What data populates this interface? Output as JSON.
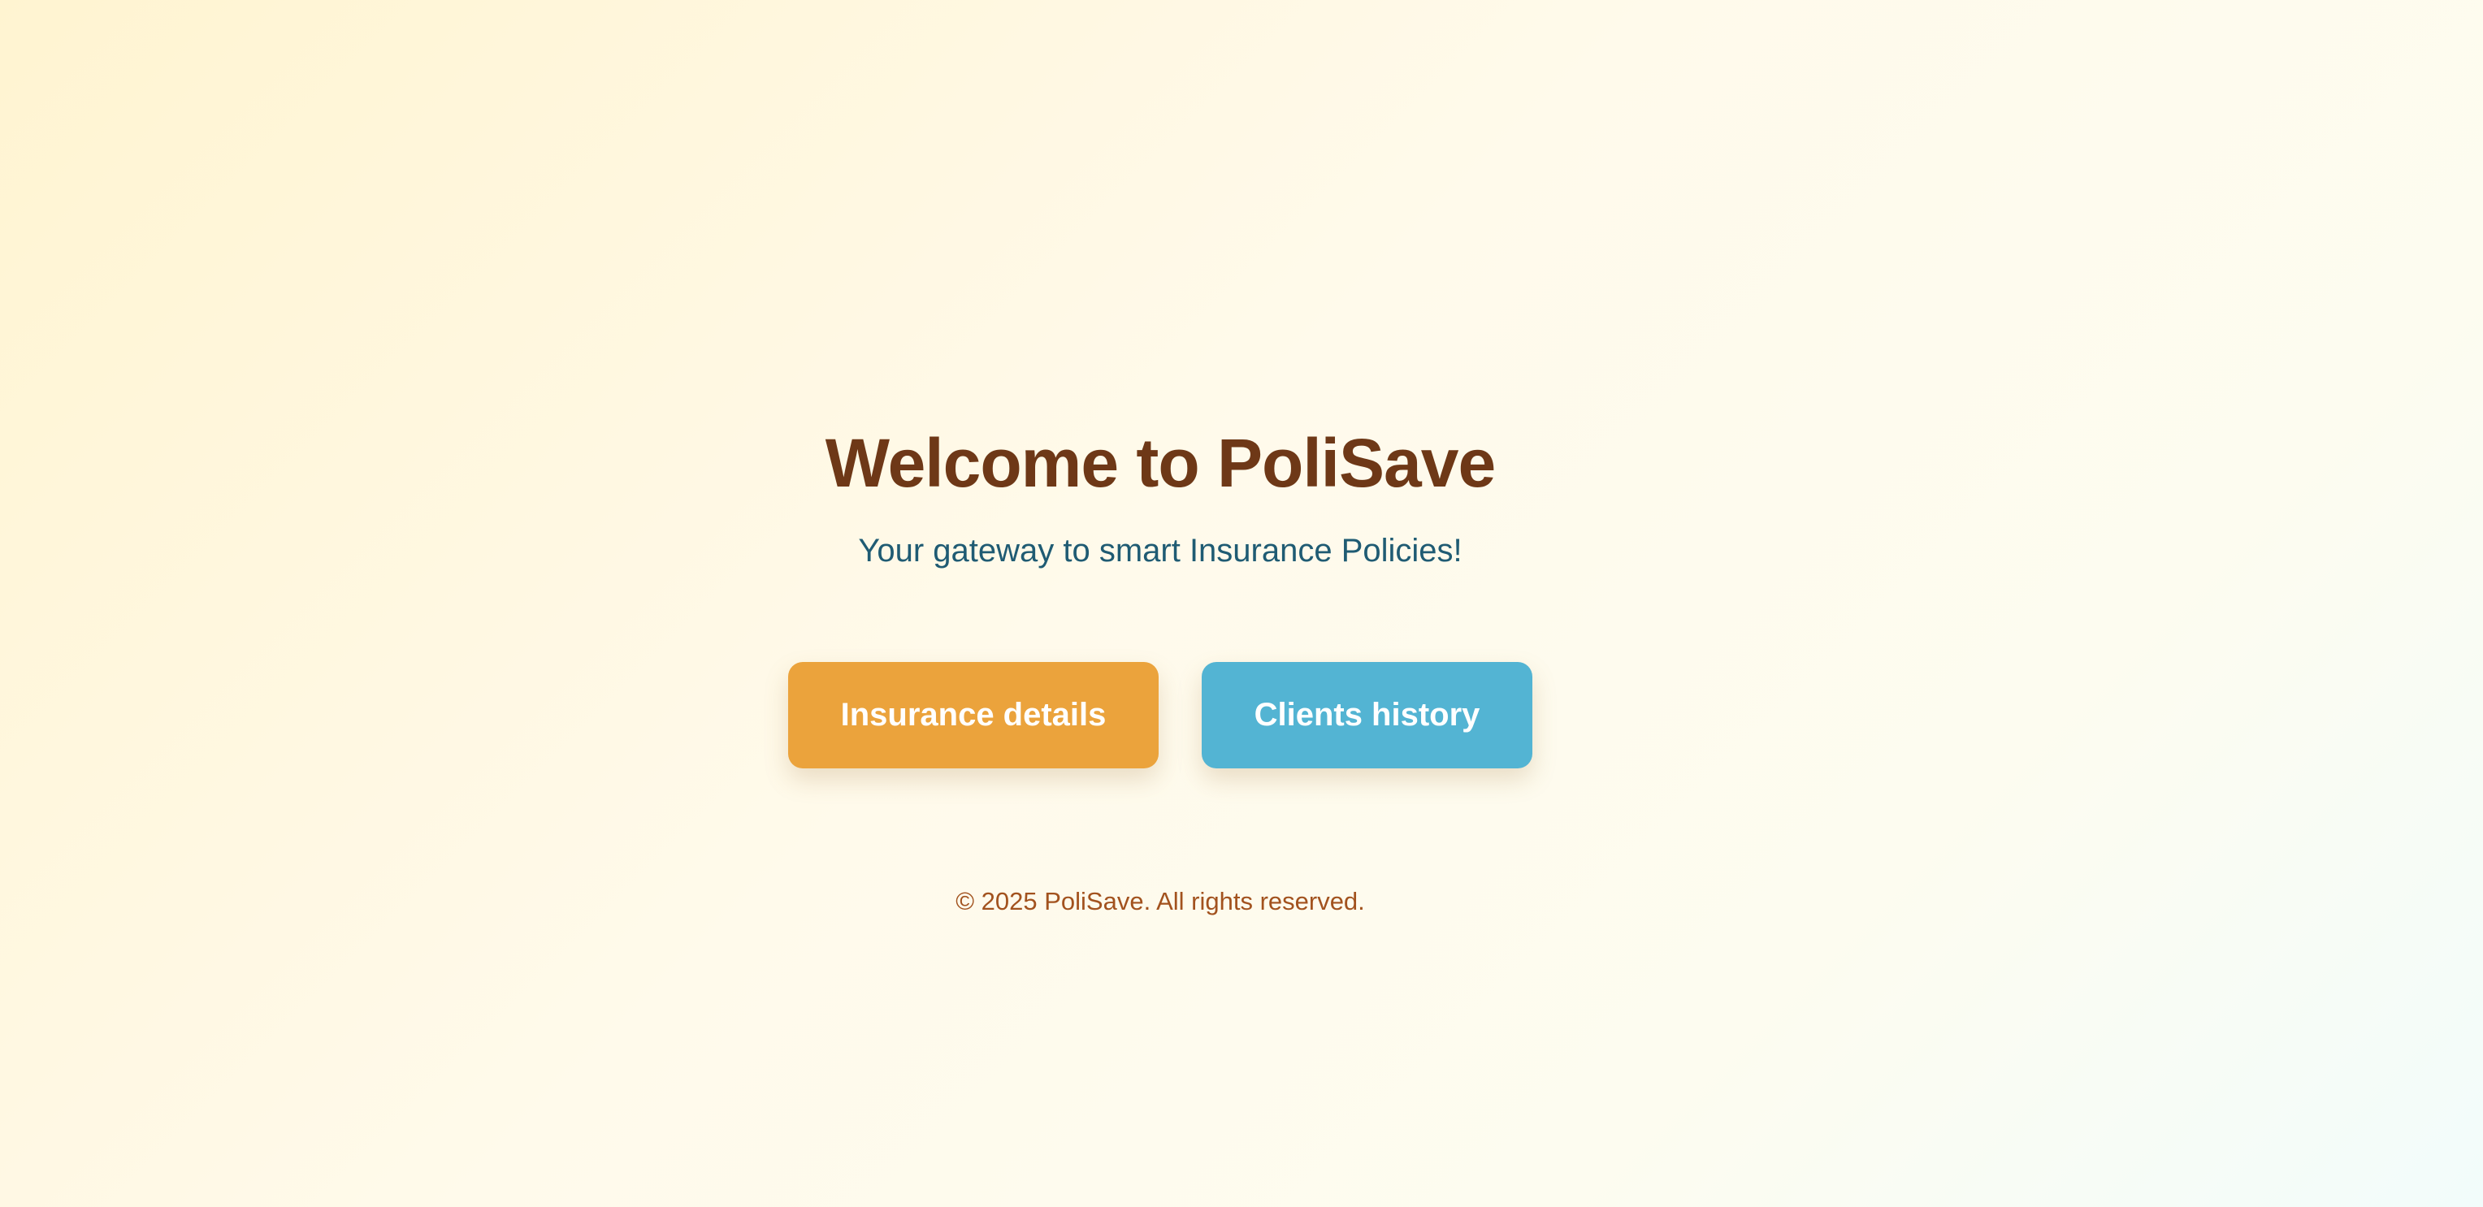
{
  "hero": {
    "title": "Welcome to PoliSave",
    "subtitle": "Your gateway to smart Insurance Policies!"
  },
  "actions": {
    "insurance_label": "Insurance details",
    "clients_label": "Clients history"
  },
  "footer": {
    "text": "© 2025 PoliSave. All rights reserved."
  },
  "colors": {
    "title": "#6e3817",
    "subtitle": "#1f5b73",
    "insurance_button": "#eba33c",
    "clients_button": "#53b4d3",
    "footer": "#a2521e"
  }
}
